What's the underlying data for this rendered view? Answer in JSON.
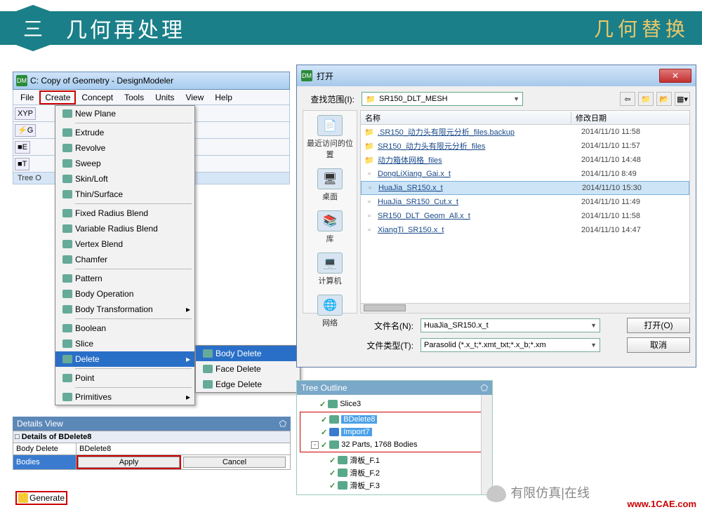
{
  "header": {
    "num": "三",
    "title": "几何再处理",
    "right": "几何替换"
  },
  "dm": {
    "title": "C: Copy of Geometry - DesignModeler",
    "menu": [
      "File",
      "Create",
      "Concept",
      "Tools",
      "Units",
      "View",
      "Help"
    ],
    "toolbar_rows": [
      [
        "XYP"
      ],
      [
        "⚡G"
      ],
      [
        "■E"
      ],
      [
        "■T"
      ]
    ],
    "tree_label": "Tree O"
  },
  "create_menu": {
    "groups": [
      [
        "New Plane"
      ],
      [
        "Extrude",
        "Revolve",
        "Sweep",
        "Skin/Loft",
        "Thin/Surface"
      ],
      [
        "Fixed Radius Blend",
        "Variable Radius Blend",
        "Vertex Blend",
        "Chamfer"
      ],
      [
        "Pattern",
        "Body Operation",
        "Body Transformation"
      ],
      [
        "Boolean",
        "Slice",
        "Delete"
      ],
      [
        "Point"
      ],
      [
        "Primitives"
      ]
    ],
    "hover": "Delete",
    "submenu": [
      "Body Delete",
      "Face Delete",
      "Edge Delete"
    ],
    "sub_hover": "Body Delete",
    "has_arrow": [
      "Body Transformation",
      "Delete",
      "Primitives"
    ]
  },
  "details": {
    "title": "Details View",
    "heading": "Details of BDelete8",
    "row1": [
      "Body Delete",
      "BDelete8"
    ],
    "row2_label": "Bodies",
    "apply": "Apply",
    "cancel": "Cancel"
  },
  "generate": "Generate",
  "filedlg": {
    "title": "打开",
    "scope_label": "查找范围(I):",
    "scope_value": "SR150_DLT_MESH",
    "places": [
      "最近访问的位置",
      "桌面",
      "库",
      "计算机",
      "网络"
    ],
    "cols": [
      "名称",
      "修改日期"
    ],
    "items": [
      {
        "t": "folder",
        "n": ".SR150_动力头有限元分析_files.backup",
        "d": "2014/11/10 11:58"
      },
      {
        "t": "folder",
        "n": "SR150_动力头有限元分析_files",
        "d": "2014/11/10 11:57"
      },
      {
        "t": "folder",
        "n": "动力箱体网格_files",
        "d": "2014/11/10 14:48"
      },
      {
        "t": "file",
        "n": "DongLiXiang_Gai.x_t",
        "d": "2014/11/10 8:49"
      },
      {
        "t": "file",
        "n": "HuaJia_SR150.x_t",
        "d": "2014/11/10 15:30",
        "sel": true
      },
      {
        "t": "file",
        "n": "HuaJia_SR150_Cut.x_t",
        "d": "2014/11/10 11:49"
      },
      {
        "t": "file",
        "n": "SR150_DLT_Geom_All.x_t",
        "d": "2014/11/10 11:58"
      },
      {
        "t": "file",
        "n": "XiangTi_SR150.x_t",
        "d": "2014/11/10 14:47"
      }
    ],
    "file_label": "文件名(N):",
    "file_value": "HuaJia_SR150.x_t",
    "type_label": "文件类型(T):",
    "type_value": "Parasolid (*.x_t;*.xmt_txt;*.x_b;*.xm",
    "open_btn": "打开(O)",
    "cancel_btn": "取消"
  },
  "tree_outline": {
    "title": "Tree Outline",
    "nodes": [
      {
        "lvl": 2,
        "ico": "g",
        "chk": true,
        "label": "Slice3"
      },
      {
        "lvl": 2,
        "ico": "g",
        "chk": true,
        "label": "BDelete8",
        "sel": true,
        "red": true
      },
      {
        "lvl": 2,
        "ico": "b",
        "chk": true,
        "label": "Import7",
        "sel": true,
        "red": true
      },
      {
        "lvl": 1,
        "exp": "-",
        "ico": "g",
        "chk": true,
        "label": "32 Parts, 1768 Bodies",
        "red": true
      },
      {
        "lvl": 3,
        "ico": "g",
        "chk": true,
        "label": "滑板_F.1"
      },
      {
        "lvl": 3,
        "ico": "g",
        "chk": true,
        "label": "滑板_F.2"
      },
      {
        "lvl": 3,
        "ico": "g",
        "chk": true,
        "label": "滑板_F.3"
      }
    ]
  },
  "footer": {
    "wechat": "有限仿真|在线",
    "url": "www.1CAE.com"
  }
}
